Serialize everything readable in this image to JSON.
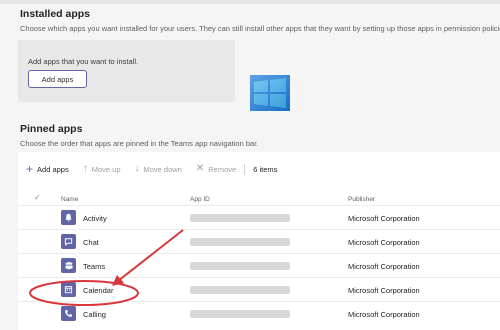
{
  "installed": {
    "title": "Installed apps",
    "description": "Choose which apps you want installed for your users. They can still install other apps that they want by setting up those apps in permission policies.",
    "box_label": "Add apps that you want to install.",
    "add_button": "Add apps"
  },
  "pinned": {
    "title": "Pinned apps",
    "description": "Choose the order that apps are pinned in the Teams app navigation bar.",
    "toolbar": {
      "add": "Add apps",
      "move_up": "Move up",
      "move_down": "Move down",
      "remove": "Remove",
      "count": "6 items"
    },
    "columns": {
      "name": "Name",
      "app_id": "App ID",
      "publisher": "Publisher"
    },
    "rows": [
      {
        "icon": "bell-icon",
        "name": "Activity",
        "publisher": "Microsoft Corporation"
      },
      {
        "icon": "chat-icon",
        "name": "Chat",
        "publisher": "Microsoft Corporation"
      },
      {
        "icon": "teams-icon",
        "name": "Teams",
        "publisher": "Microsoft Corporation"
      },
      {
        "icon": "calendar-icon",
        "name": "Calendar",
        "publisher": "Microsoft Corporation"
      },
      {
        "icon": "phone-icon",
        "name": "Calling",
        "publisher": "Microsoft Corporation"
      }
    ]
  },
  "colors": {
    "accent": "#6264a7",
    "annotation": "#d9373c"
  }
}
